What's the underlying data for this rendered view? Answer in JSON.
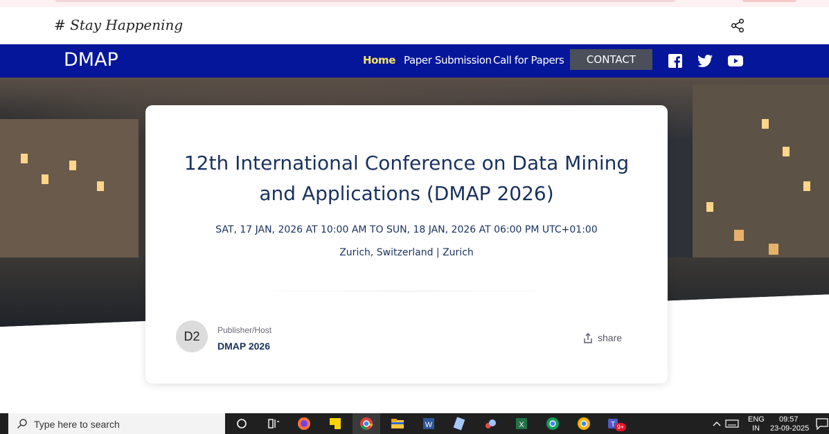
{
  "tagline": "# Stay Happening",
  "nav": {
    "brand": "DMAP",
    "home": "Home",
    "paper_submission": "Paper Submission",
    "call_for_papers": "Call for Papers",
    "contact": "CONTACT",
    "social_icons": [
      "facebook-icon",
      "twitter-icon",
      "youtube-icon"
    ]
  },
  "event": {
    "title": "12th International Conference on Data Mining and Applications (DMAP 2026)",
    "datetime": "SAT, 17 JAN, 2026 AT 10:00 AM TO SUN, 18 JAN, 2026 AT 06:00 PM UTC+01:00",
    "location": "Zurich, Switzerland | Zurich",
    "host_initials": "D2",
    "host_label": "Publisher/Host",
    "host_name": "DMAP 2026",
    "share_label": "share"
  },
  "taskbar": {
    "search_placeholder": "Type here to search",
    "lang_line1": "ENG",
    "lang_line2": "IN",
    "time": "09:57",
    "date": "23-09-2025",
    "teams_badge": "9+"
  },
  "colors": {
    "nav_bg": "#05169a",
    "accent_active": "#f7e36a",
    "title_text": "#17315e",
    "contact_bg": "#4a4f5a"
  }
}
